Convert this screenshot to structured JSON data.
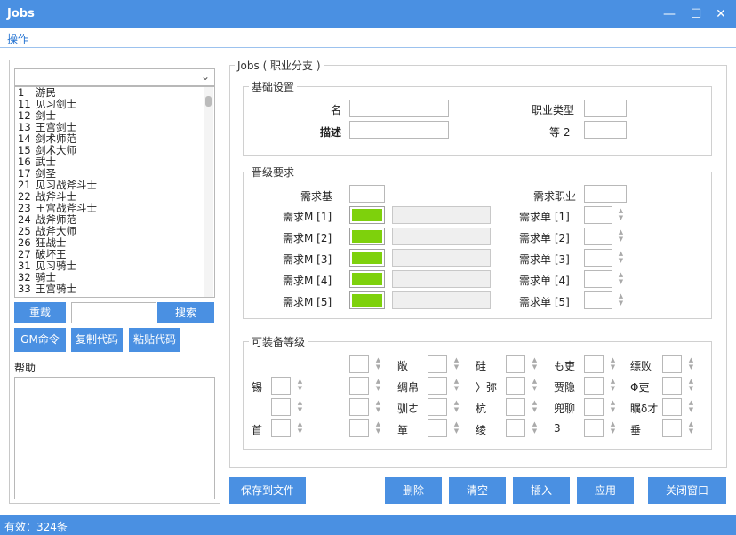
{
  "window": {
    "title": "Jobs",
    "min": "—",
    "max": "☐",
    "close": "✕"
  },
  "menu": {
    "ops": "操作"
  },
  "left": {
    "jobs": [
      {
        "id": "1",
        "name": "游民"
      },
      {
        "id": "11",
        "name": "见习剑士"
      },
      {
        "id": "12",
        "name": "剑士"
      },
      {
        "id": "13",
        "name": "王宫剑士"
      },
      {
        "id": "14",
        "name": "剑术师范"
      },
      {
        "id": "15",
        "name": "剑术大师"
      },
      {
        "id": "16",
        "name": "武士"
      },
      {
        "id": "17",
        "name": "剑圣"
      },
      {
        "id": "21",
        "name": "见习战斧斗士"
      },
      {
        "id": "22",
        "name": "战斧斗士"
      },
      {
        "id": "23",
        "name": "王宫战斧斗士"
      },
      {
        "id": "24",
        "name": "战斧师范"
      },
      {
        "id": "25",
        "name": "战斧大师"
      },
      {
        "id": "26",
        "name": "狂战士"
      },
      {
        "id": "27",
        "name": "破坏王"
      },
      {
        "id": "31",
        "name": "见习骑士"
      },
      {
        "id": "32",
        "name": "骑士"
      },
      {
        "id": "33",
        "name": "王宫骑士"
      }
    ],
    "reload": "重载",
    "search": "搜索",
    "gm": "GM命令",
    "copy": "复制代码",
    "paste": "粘贴代码",
    "note_label": "帮助"
  },
  "right": {
    "title": "Jobs ( 职业分支 )",
    "basic": {
      "title": "基础设置",
      "name": "名",
      "desc": "描述",
      "type_label": "职业类型",
      "tier_label": "等 2"
    },
    "advance": {
      "title": "晋级要求",
      "base": "需求基",
      "base_right": "需求职业",
      "rows": [
        "需求M  [1]",
        "需求M  [2]",
        "需求M  [3]",
        "需求M  [4]",
        "需求M  [5]"
      ],
      "rrows": [
        "需求单  [1]",
        "需求单  [2]",
        "需求单  [3]",
        "需求单  [4]",
        "需求单  [5]"
      ]
    },
    "equip": {
      "title": "可装备等级",
      "labels": {
        "c0": [
          "",
          "锡",
          "",
          "首"
        ],
        "c1": [
          "敞",
          "绸帛",
          "驯ㄜ",
          "箪"
        ],
        "c2": [
          "硅",
          "〉弥",
          "杭",
          "绫"
        ],
        "c3": [
          "も吏",
          "贾隐",
          "兜聊",
          "3"
        ],
        "c4": [
          "缥败",
          "Φ吏",
          "瞩δ才",
          "垂"
        ]
      }
    }
  },
  "buttons": {
    "save": "保存到文件",
    "delete": "删除",
    "clear": "清空",
    "insert": "插入",
    "apply": "应用",
    "close": "关闭窗口"
  },
  "status": {
    "text": "有效：324条"
  }
}
